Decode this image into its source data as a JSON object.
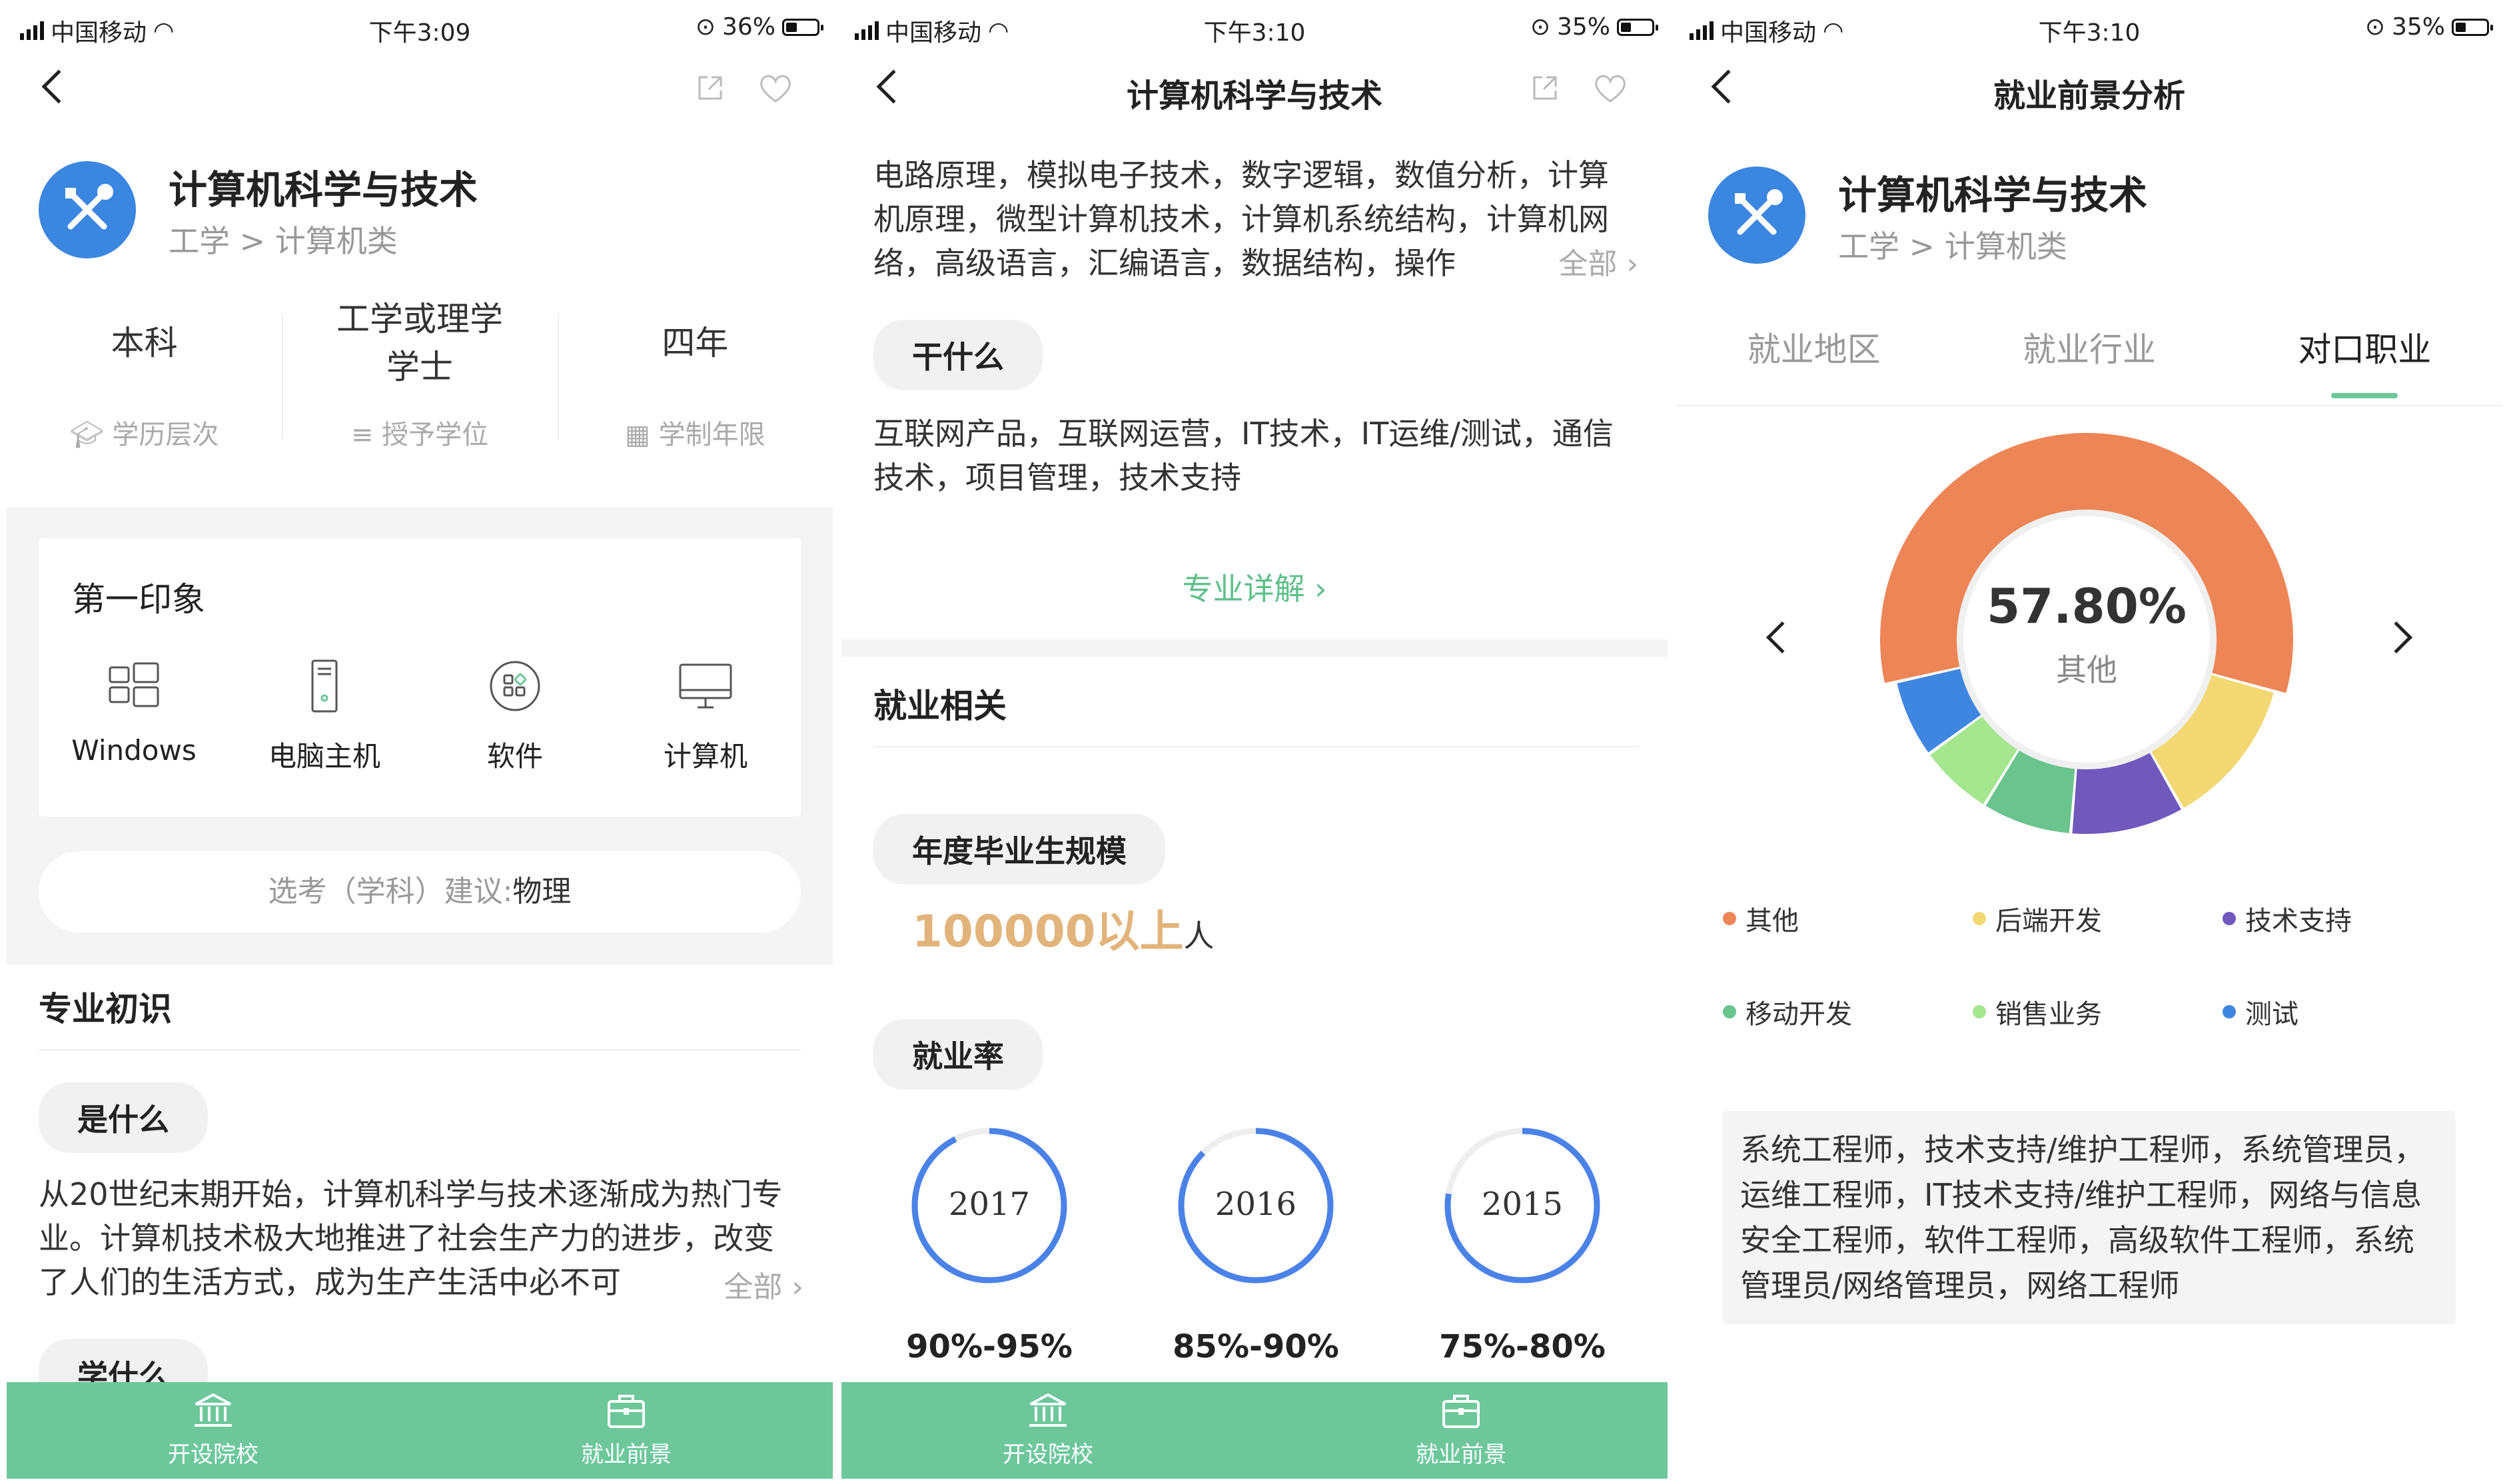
{
  "status": [
    {
      "carrier": "中国移动",
      "time": "下午3:09",
      "battery": "36%",
      "battery_fraction": 0.36
    },
    {
      "carrier": "中国移动",
      "time": "下午3:10",
      "battery": "35%",
      "battery_fraction": 0.35
    },
    {
      "carrier": "中国移动",
      "time": "下午3:10",
      "battery": "35%",
      "battery_fraction": 0.35
    }
  ],
  "panel1": {
    "major_name": "计算机科学与技术",
    "category": "工学 > 计算机类",
    "stats": [
      {
        "value": "本科",
        "label": "学历层次",
        "icon": "graduation-cap-icon"
      },
      {
        "value": "工学或理学学士",
        "label": "授予学位",
        "icon": "degree-icon"
      },
      {
        "value": "四年",
        "label": "学制年限",
        "icon": "calendar-icon"
      }
    ],
    "impression_title": "第一印象",
    "impressions": [
      {
        "label": "Windows",
        "icon": "windows-icon"
      },
      {
        "label": "电脑主机",
        "icon": "pc-tower-icon"
      },
      {
        "label": "软件",
        "icon": "software-icon"
      },
      {
        "label": "计算机",
        "icon": "monitor-icon"
      }
    ],
    "suggest_prefix": "选考（学科）建议:",
    "suggest_value": "物理",
    "intro_title": "专业初识",
    "what_pill": "是什么",
    "what_text": "从20世纪末期开始，计算机科学与技术逐渐成为热门专业。计算机技术极大地推进了社会生产力的进步，改变了人们的生活方式，成为生产生活中必不可",
    "more_label": "全部 ›",
    "learn_pill": "学什么"
  },
  "panel2": {
    "title": "计算机科学与技术",
    "courses_text": "电路原理，模拟电子技术，数字逻辑，数值分析，计算机原理，微型计算机技术，计算机系统结构，计算机网络，高级语言，汇编语言，数据结构，操作",
    "more_label": "全部 ›",
    "do_pill": "干什么",
    "do_text": "互联网产品，互联网运营，IT技术，IT运维/测试，通信技术，项目管理，技术支持",
    "detail_link": "专业详解 ›",
    "employment_title": "就业相关",
    "grads_pill": "年度毕业生规模",
    "grads_value": "100000以上",
    "grads_unit": "人",
    "rate_pill": "就业率",
    "rates": [
      {
        "year": "2017",
        "range": "90%-95%",
        "fill": 0.925
      },
      {
        "year": "2016",
        "range": "85%-90%",
        "fill": 0.875
      },
      {
        "year": "2015",
        "range": "75%-80%",
        "fill": 0.775
      }
    ]
  },
  "panel3": {
    "title": "就业前景分析",
    "major_name": "计算机科学与技术",
    "category": "工学 > 计算机类",
    "tabs": [
      "就业地区",
      "就业行业",
      "对口职业"
    ],
    "active_tab": 2,
    "center_value": "57.80%",
    "center_label": "其他",
    "chart_data": {
      "type": "pie",
      "title": "",
      "slices": [
        {
          "name": "其他",
          "value": 57.8,
          "color": "#ee8556"
        },
        {
          "name": "后端开发",
          "value": 12.5,
          "color": "#f3d873"
        },
        {
          "name": "技术支持",
          "value": 9.5,
          "color": "#7058bd"
        },
        {
          "name": "移动开发",
          "value": 7.5,
          "color": "#6bc48e"
        },
        {
          "name": "销售业务",
          "value": 6.2,
          "color": "#a5e68f"
        },
        {
          "name": "测试",
          "value": 6.5,
          "color": "#3f86e0"
        }
      ],
      "legend_position": "bottom"
    },
    "jobs_text": "系统工程师，技术支持/维护工程师，系统管理员，运维工程师，IT技术支持/维护工程师，网络与信息安全工程师，软件工程师，高级软件工程师，系统管理员/网络管理员，网络工程师"
  },
  "bottom_tabs": [
    {
      "label": "开设院校",
      "icon": "institution-icon"
    },
    {
      "label": "就业前景",
      "icon": "briefcase-icon"
    }
  ],
  "colors": {
    "accent": "#6dc79b",
    "logo": "#3b86e0",
    "count": "#e2b47b"
  }
}
